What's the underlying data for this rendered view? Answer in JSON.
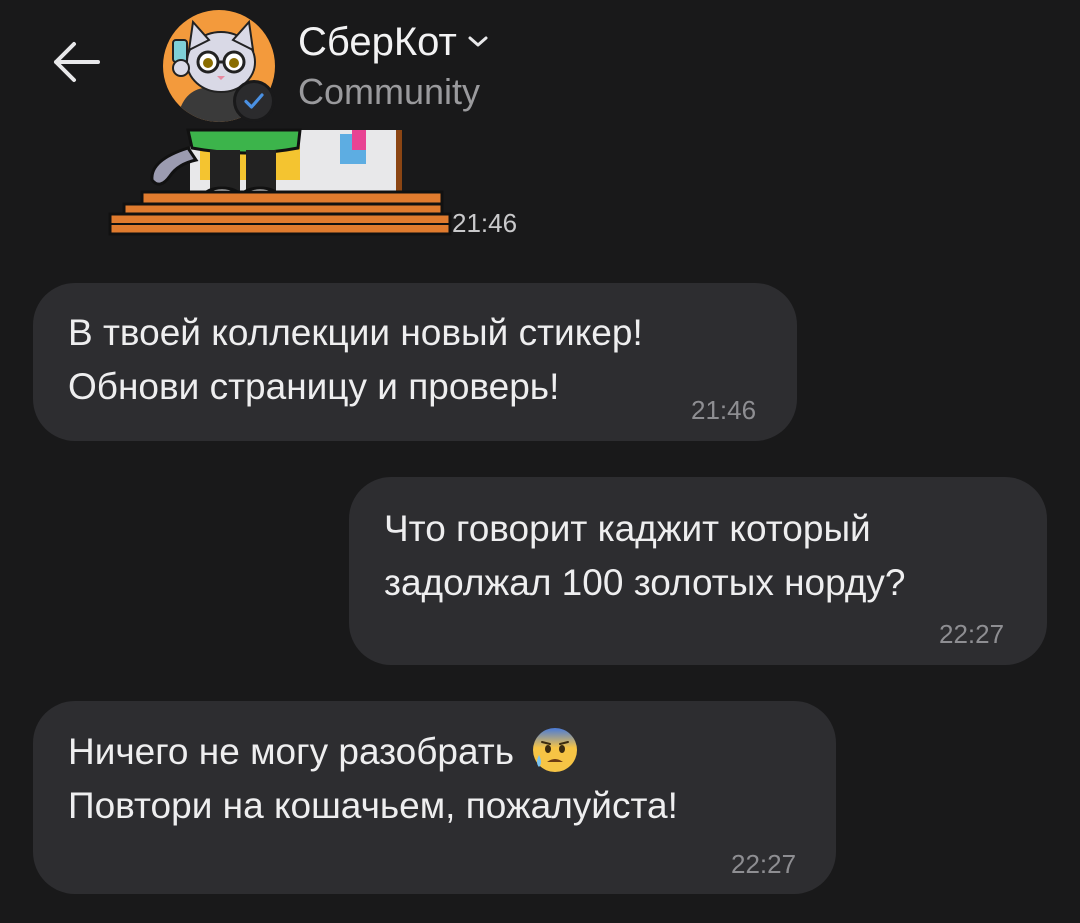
{
  "header": {
    "back_icon": "arrow-left-icon",
    "chat_name": "СберКот",
    "chevron_icon": "chevron-down-icon",
    "chat_type": "Community",
    "verified_icon": "check-badge-icon"
  },
  "messages": [
    {
      "id": "sticker",
      "kind": "sticker",
      "side": "in",
      "time": "21:46"
    },
    {
      "id": "m1",
      "side": "in",
      "lines": [
        "В твоей коллекции новый стикер!",
        "Обнови страницу и проверь!"
      ],
      "time": "21:46"
    },
    {
      "id": "m2",
      "side": "out",
      "lines": [
        "Что говорит каджит который",
        "задолжал 100 золотых норду?"
      ],
      "time": "22:27"
    },
    {
      "id": "m3",
      "side": "in",
      "lines": [
        "Ничего не могу разобрать",
        "Повтори на кошачьем, пожалуйста!"
      ],
      "emoji": "anxious-face-with-sweat",
      "time": "22:27"
    }
  ],
  "colors": {
    "background": "#19191a",
    "bubble": "#2d2d30",
    "text": "#eeeeef",
    "time": "#8e8e92",
    "verified_blue": "#4a90e2"
  }
}
